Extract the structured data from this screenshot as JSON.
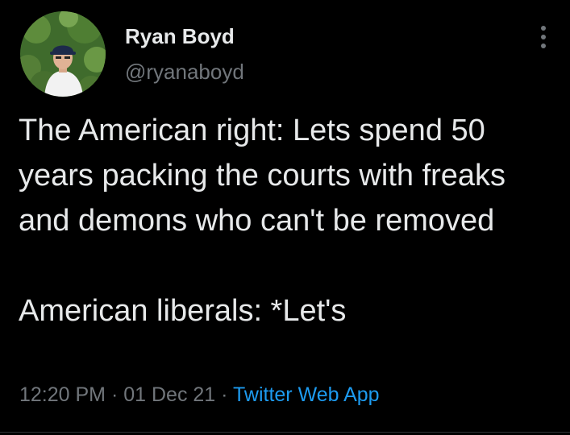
{
  "author": {
    "display_name": "Ryan Boyd",
    "handle": "@ryanaboyd",
    "avatar_icon": "profile-photo"
  },
  "more_icon": "more-vertical-icon",
  "tweet": {
    "paragraph_1": "The American right: Lets spend 50 years packing the courts with freaks and demons who can't be removed",
    "paragraph_2": "American liberals: *Let's"
  },
  "meta": {
    "time": "12:20 PM",
    "separator": "·",
    "date": "01 Dec 21",
    "source": "Twitter Web App"
  },
  "colors": {
    "background": "#000000",
    "primary_text": "#e7e9ea",
    "secondary_text": "#71767b",
    "link": "#1d9bf0"
  }
}
